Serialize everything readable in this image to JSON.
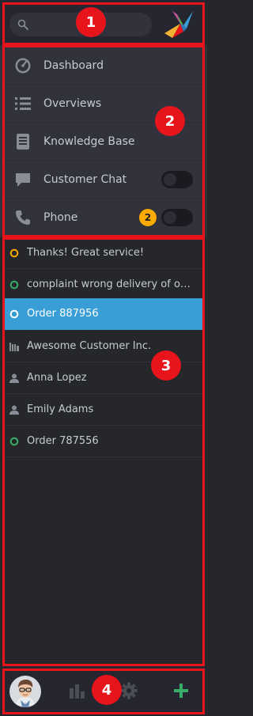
{
  "annotations": [
    "1",
    "2",
    "3",
    "4"
  ],
  "header": {
    "search_placeholder": "",
    "search_icon": "search-icon",
    "logo": "zammad-bird-logo"
  },
  "nav": {
    "items": [
      {
        "label": "Dashboard",
        "icon": "speedometer-icon"
      },
      {
        "label": "Overviews",
        "icon": "list-icon"
      },
      {
        "label": "Knowledge Base",
        "icon": "book-icon"
      },
      {
        "label": "Customer Chat",
        "icon": "chat-icon",
        "toggle": "off"
      },
      {
        "label": "Phone",
        "icon": "phone-icon",
        "badge": "2",
        "toggle": "off"
      }
    ]
  },
  "tasks": {
    "items": [
      {
        "label": "Thanks! Great service!",
        "icon": "ring-open-icon",
        "status_color": "#faab00"
      },
      {
        "label": "complaint wrong delivery of ord…",
        "icon": "ring-open-icon",
        "status_color": "#38ad69"
      },
      {
        "label": "Order 887956",
        "icon": "ring-open-icon",
        "status_color": "#ffffff",
        "active": true
      },
      {
        "label": "Awesome Customer Inc.",
        "icon": "organization-icon"
      },
      {
        "label": "Anna Lopez",
        "icon": "user-icon"
      },
      {
        "label": "Emily Adams",
        "icon": "user-icon"
      },
      {
        "label": "Order 787556",
        "icon": "ring-open-icon",
        "status_color": "#38ad69"
      }
    ]
  },
  "bottom": {
    "avatar": "user-avatar",
    "stats_icon": "stats-icon",
    "gear_icon": "gear-icon",
    "plus_icon": "plus-icon"
  },
  "colors": {
    "accent_blue": "#389ed5",
    "annotation_red": "#e8141c",
    "green": "#38ad69",
    "yellow": "#faab00"
  }
}
